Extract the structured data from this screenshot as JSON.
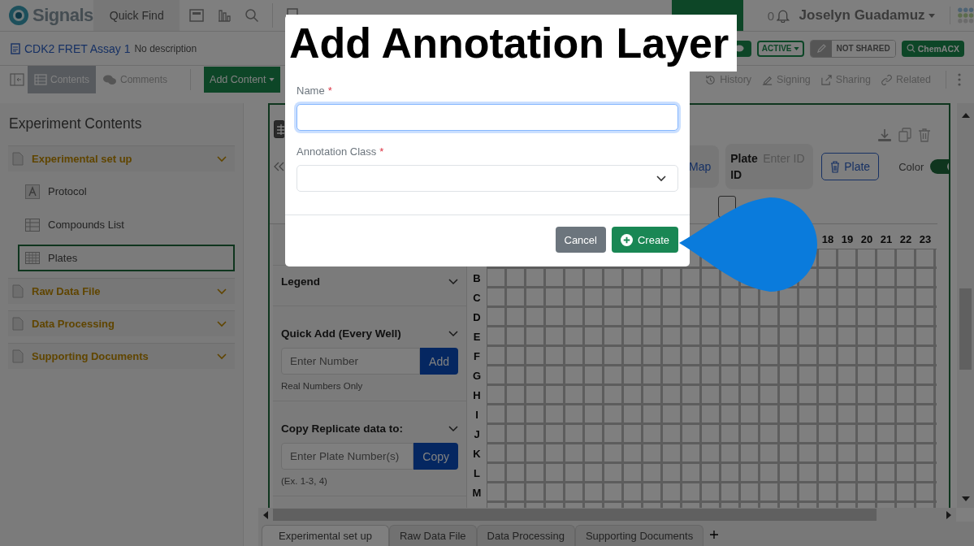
{
  "top_bar": {
    "logo": "Signals",
    "quick_find": "Quick Find",
    "notification_count": "0",
    "user": "Joselyn Guadamuz"
  },
  "experiment": {
    "title": "CDK2 FRET Assay 1",
    "description": "No description",
    "status": "ACTIVE",
    "sharing": "NOT SHARED",
    "search_button": "ChemACX"
  },
  "toolbar": {
    "tabs": [
      {
        "label": "Contents",
        "selected": true
      },
      {
        "label": "Comments",
        "selected": false
      }
    ],
    "add_content": "Add Content",
    "actions": [
      "History",
      "Signing",
      "Sharing",
      "Related"
    ]
  },
  "sidebar": {
    "title": "Experiment Contents",
    "sections": [
      {
        "label": "Experimental set up",
        "children": [
          {
            "label": "Protocol",
            "kind": "text",
            "selected": false
          },
          {
            "label": "Compounds List",
            "kind": "table",
            "selected": false
          },
          {
            "label": "Plates",
            "kind": "plate",
            "selected": true
          }
        ]
      },
      {
        "label": "Raw Data File"
      },
      {
        "label": "Data Processing"
      },
      {
        "label": "Supporting Documents"
      }
    ]
  },
  "plate": {
    "map_button": "Map",
    "plate_id_label": "Plate ID",
    "plate_id_placeholder": "Enter ID",
    "delete_button": "Plate",
    "color_label": "Color",
    "color_on": true,
    "legend": "Legend",
    "quick_add": {
      "title": "Quick Add (Every Well)",
      "placeholder": "Enter Number",
      "button": "Add",
      "hint": "Real Numbers Only"
    },
    "copy_replicate": {
      "title": "Copy Replicate data to:",
      "placeholder": "Enter Plate Number(s)",
      "button": "Copy",
      "hint": "(Ex. 1-3, 4)"
    },
    "column_headers": [
      "18",
      "19",
      "20",
      "21",
      "22",
      "23"
    ],
    "row_labels": [
      "B",
      "C",
      "D",
      "E",
      "F",
      "G",
      "H",
      "I",
      "J",
      "K",
      "L",
      "M"
    ]
  },
  "sheet_tabs": [
    {
      "label": "Experimental set up",
      "selected": true
    },
    {
      "label": "Raw Data File",
      "selected": false
    },
    {
      "label": "Data Processing",
      "selected": false
    },
    {
      "label": "Supporting Documents",
      "selected": false
    }
  ],
  "dialog": {
    "title": "Add Annotation Layer",
    "fields": [
      {
        "label": "Name",
        "required_mark": "*",
        "kind": "text",
        "focused": true
      },
      {
        "label": "Annotation Class",
        "required_mark": "*",
        "kind": "select",
        "focused": false
      }
    ],
    "buttons": [
      {
        "label": "Cancel",
        "kind": "secondary"
      },
      {
        "label": "Create",
        "kind": "primary"
      }
    ]
  }
}
